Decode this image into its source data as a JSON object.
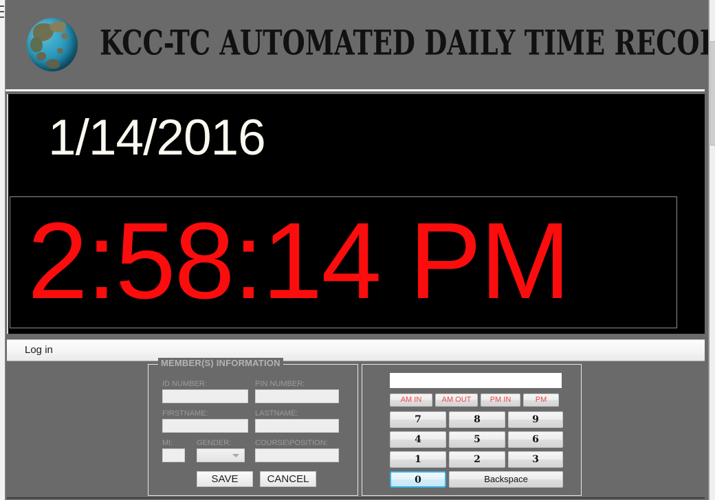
{
  "window": {
    "header": {
      "title": "KCC-TC AUTOMATED DAILY TIME RECORD",
      "logo_icon": "globe-icon"
    },
    "clock": {
      "date": "1/14/2016",
      "time": "2:58:14 PM",
      "date_color": "#FBF8F0",
      "time_color": "#FB0D0D",
      "background_color": "#000000"
    },
    "menu": {
      "items": [
        {
          "label": "Log in"
        }
      ]
    },
    "member_group": {
      "legend": "MEMBER(S) INFORMATION",
      "fields": [
        {
          "key": "id_number",
          "label": "ID NUMBER:",
          "value": "",
          "placeholder": ""
        },
        {
          "key": "pin_number",
          "label": "PIN NUMBER:",
          "value": "",
          "placeholder": ""
        },
        {
          "key": "firstname",
          "label": "FIRSTNAME:",
          "value": "",
          "placeholder": ""
        },
        {
          "key": "lastname",
          "label": "LASTNAME:",
          "value": "",
          "placeholder": ""
        },
        {
          "key": "mi",
          "label": "MI:",
          "value": "",
          "placeholder": ""
        },
        {
          "key": "gender",
          "label": "GENDER:",
          "value": "",
          "placeholder": ""
        },
        {
          "key": "course_position",
          "label": "COURSE\\POSITION:",
          "value": "",
          "placeholder": ""
        }
      ],
      "gender_selected": "",
      "buttons": [
        {
          "key": "save",
          "label": "SAVE"
        },
        {
          "key": "cancel",
          "label": "CANCEL"
        }
      ]
    },
    "keypad": {
      "display_value": "",
      "display_placeholder": "",
      "period_buttons": [
        {
          "key": "am_in",
          "label": "AM IN"
        },
        {
          "key": "am_out",
          "label": "AM OUT"
        },
        {
          "key": "pm_in",
          "label": "PM IN"
        },
        {
          "key": "pm_out",
          "label": "PM"
        }
      ],
      "number_rows": [
        [
          "7",
          "8",
          "9"
        ],
        [
          "4",
          "5",
          "6"
        ],
        [
          "1",
          "2",
          "3"
        ]
      ],
      "zero_label": "0",
      "backspace_label": "Backspace",
      "focused_button": "0",
      "focus_color": "#35B3EA",
      "period_label_color": "#F04545"
    },
    "colors": {
      "chrome_gray": "#6A6A6A",
      "panel_border": "#E8E8E8",
      "menu_background": "#F4F4F4"
    }
  }
}
